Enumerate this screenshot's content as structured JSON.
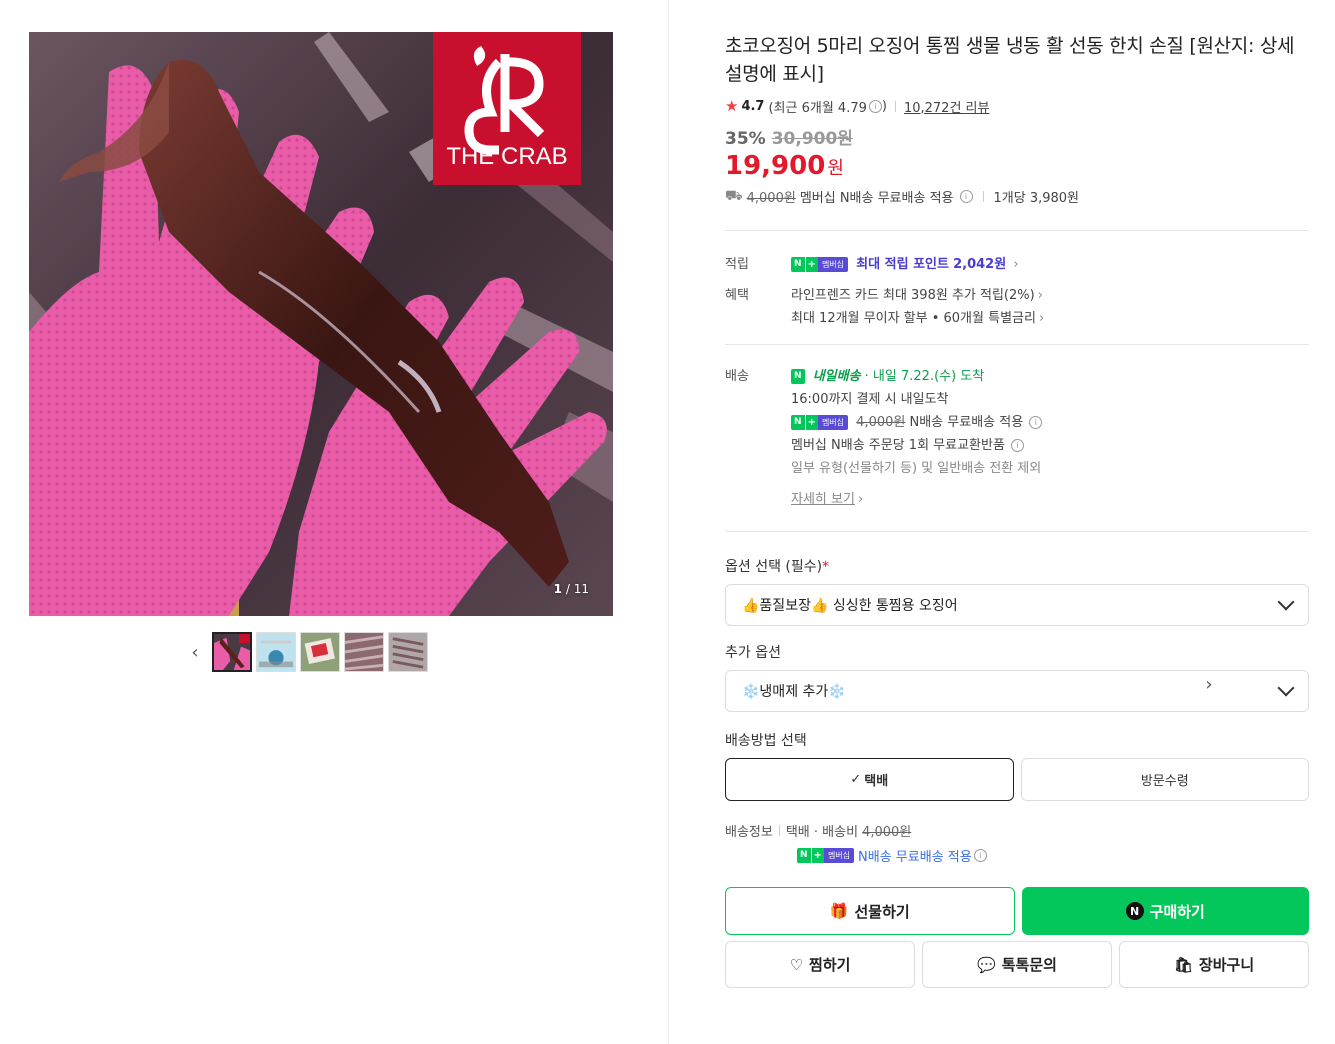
{
  "gallery": {
    "logo_text": "THE CRAB",
    "counter_current": "1",
    "counter_total": "11",
    "thumb_count": 5
  },
  "product": {
    "title": "초코오징어 5마리 오징어 통찜 생물 냉동 활 선동 한치 손질 [원산지: 상세설명에 표시]",
    "rating": "4.7",
    "recent_rating": "(최근 6개월 4.79",
    "recent_close": ")",
    "reviews": "10,272건 리뷰",
    "discount": "35%",
    "original_price": "30,900원",
    "price": "19,900",
    "currency": "원",
    "ship_fee": "4,000원",
    "ship_note": "멤버십 N배송 무료배송 적용",
    "unit_price": "1개당 3,980원"
  },
  "benefits": {
    "points_label": "적립",
    "points_text": "최대 적립 포인트",
    "points_value": "2,042원",
    "benefit_label": "혜택",
    "card_text": "라인프렌즈 카드 최대 398원 추가 적립(2%)",
    "installment_text": "최대 12개월 무이자 할부 • 60개월 특별금리",
    "badge_n": "N",
    "badge_plus": "+",
    "badge_member": "멤버십"
  },
  "delivery": {
    "label": "배송",
    "nextday_brand": "내일배송",
    "arrival": "· 내일 7.22.(수) 도착",
    "cutoff": "16:00까지 결제 시 내일도착",
    "fee_strike": "4,000원",
    "fee_note": "N배송 무료배송 적용",
    "exchange": "멤버십 N배송 주문당 1회 무료교환반품",
    "exclusion": "일부 유형(선물하기 등) 및 일반배송 전환 제외",
    "more": "자세히 보기"
  },
  "options": {
    "required_label": "옵션 선택 (필수)",
    "required_star": "*",
    "required_value": "👍품질보장👍 싱싱한 통찜용 오징어",
    "extra_label": "추가 옵션",
    "extra_value": "❄️냉매제 추가❄️",
    "method_label": "배송방법 선택",
    "method_delivery": "택배",
    "method_pickup": "방문수령",
    "info_label": "배송정보",
    "info_text": "택배 · 배송비",
    "info_fee": "4,000원",
    "info_free": "N배송 무료배송 적용"
  },
  "actions": {
    "gift": "선물하기",
    "buy": "구매하기",
    "wish": "찜하기",
    "talk": "톡톡문의",
    "cart": "장바구니"
  },
  "colors": {
    "naver_green": "#03c75a",
    "price_red": "#e1192b",
    "member_purple": "#4a3bd2",
    "logo_red": "#c8102e"
  }
}
